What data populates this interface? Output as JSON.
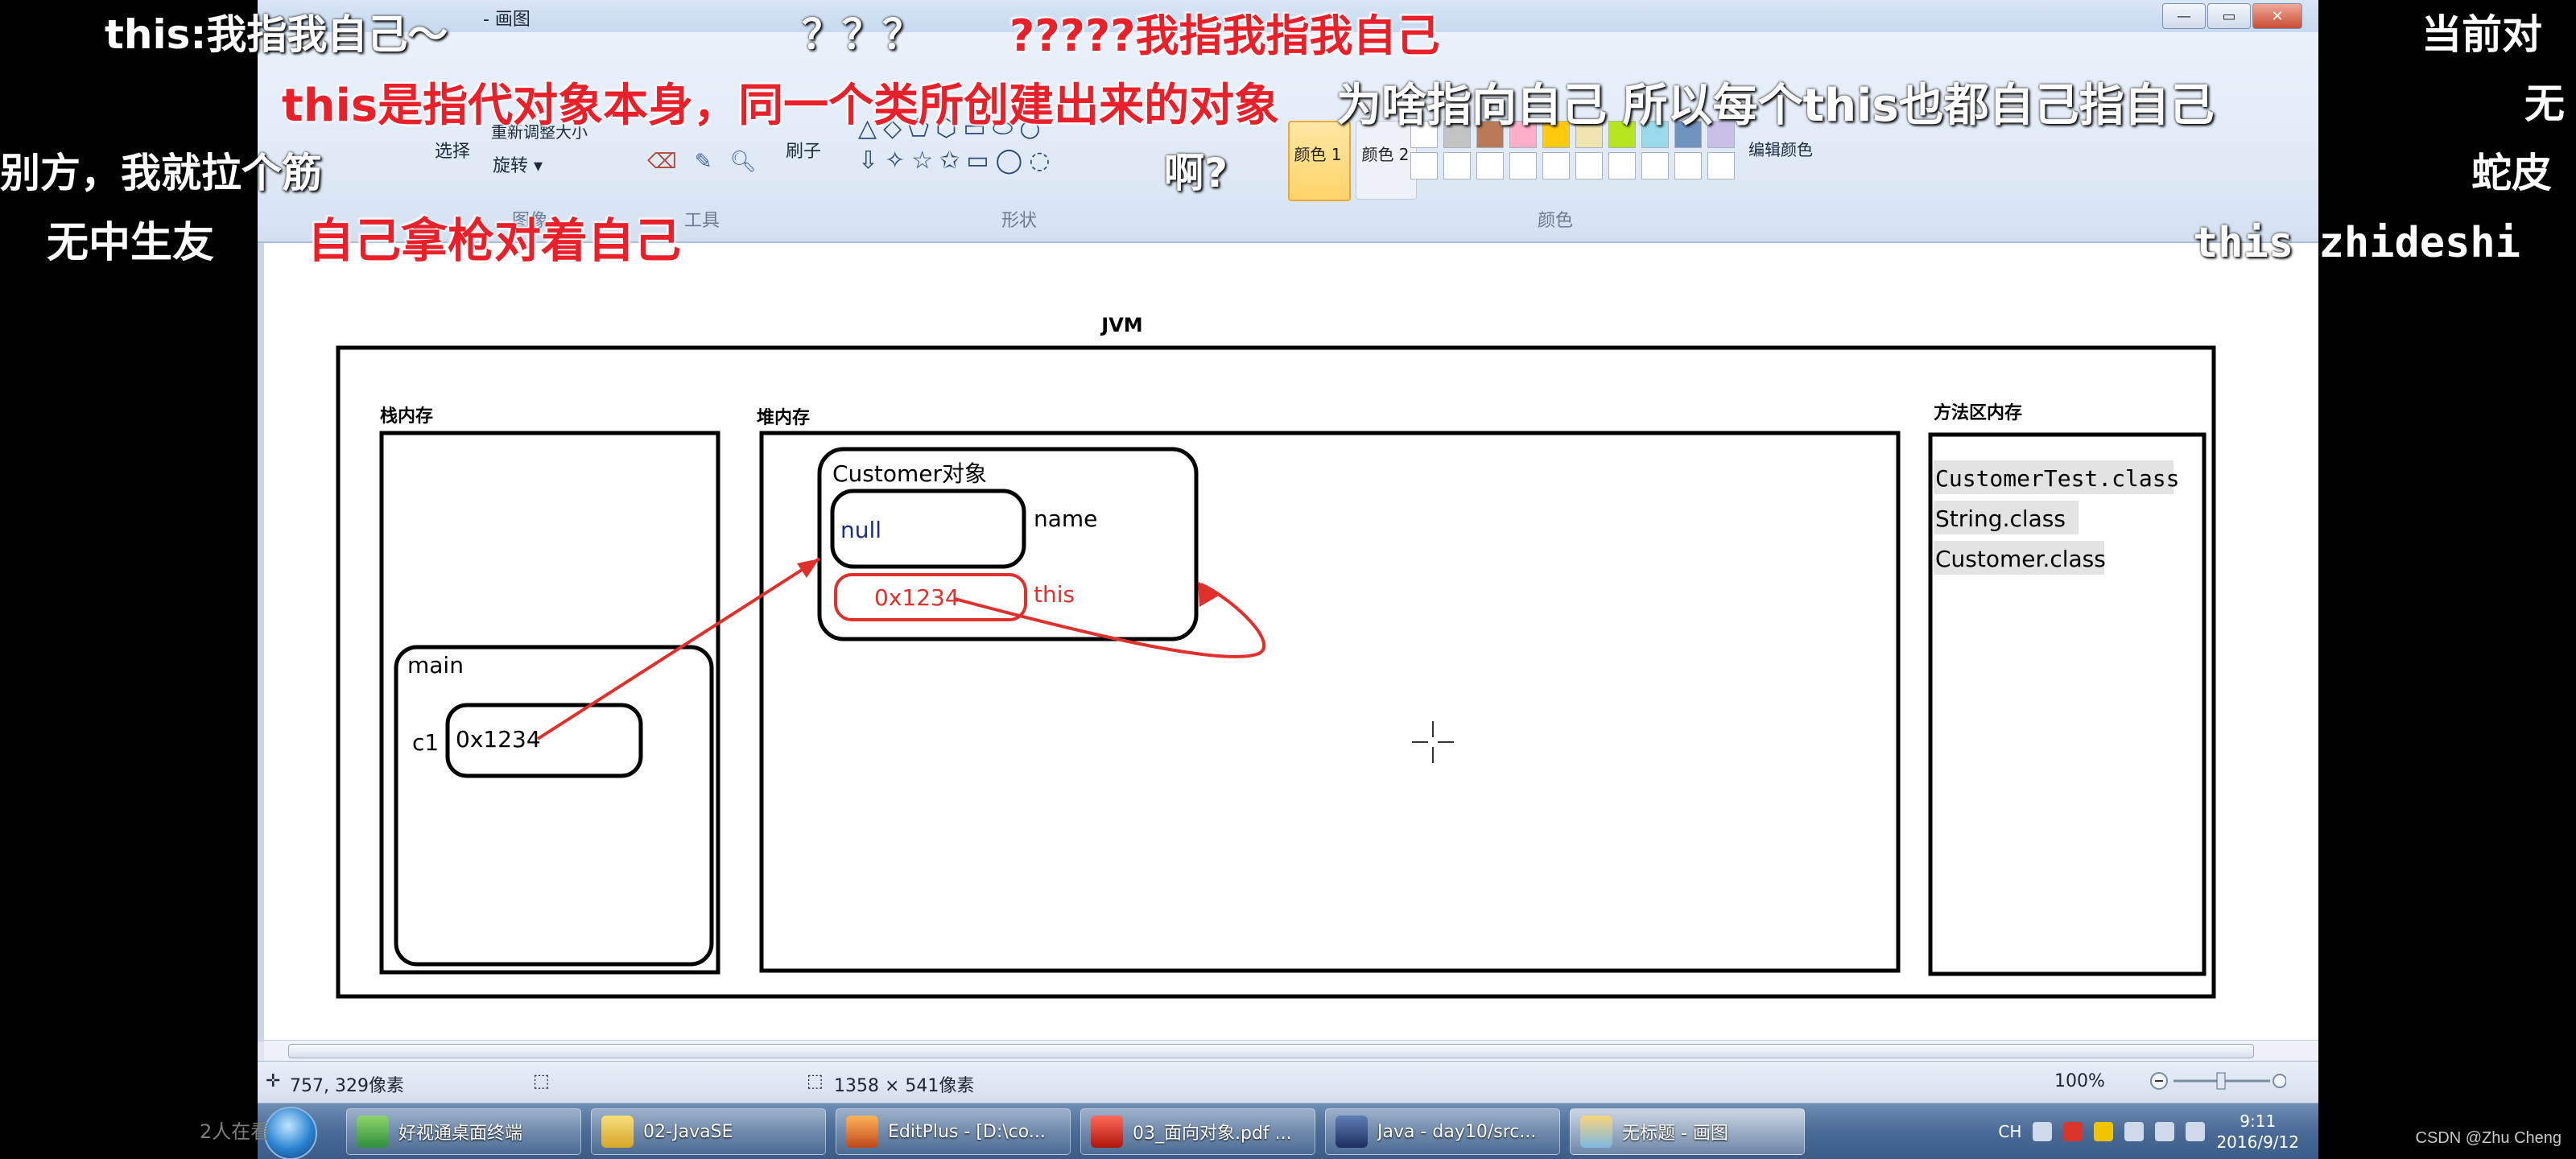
{
  "app": {
    "title_fragment": "- 画图"
  },
  "ribbon": {
    "groups": [
      {
        "label": "图像"
      },
      {
        "label": "工具"
      },
      {
        "label": "形状"
      },
      {
        "label": "颜色"
      }
    ],
    "select_label": "选择",
    "rotate_label": "旋转 ▾",
    "resize_label": "重新调整大小",
    "brush_label": "刷子",
    "color1_label": "颜色 1",
    "color2_label": "颜色 2",
    "edit_colors_label": "编辑颜色"
  },
  "diagram": {
    "title": "JVM",
    "stack": {
      "label": "栈内存",
      "frame": "main",
      "var_name": "c1",
      "var_value": "0x1234"
    },
    "heap": {
      "label": "堆内存",
      "object_title": "Customer对象",
      "field_value": "null",
      "field_name": "name",
      "this_value": "0x1234",
      "this_name": "this"
    },
    "method_area": {
      "label": "方法区内存",
      "classes": [
        "CustomerTest.class",
        "String.class",
        "Customer.class"
      ]
    }
  },
  "statusbar": {
    "cursor_pos": "757, 329像素",
    "canvas_size": "1358 × 541像素",
    "zoom": "100%"
  },
  "taskbar": {
    "items": [
      {
        "label": "好视通桌面终端"
      },
      {
        "label": "02-JavaSE"
      },
      {
        "label": "EditPlus - [D:\\co..."
      },
      {
        "label": "03_面向对象.pdf ..."
      },
      {
        "label": "Java - day10/src..."
      },
      {
        "label": "无标题 - 画图"
      }
    ],
    "lang": "CH",
    "time": "9:11",
    "date": "2016/9/12"
  },
  "danmaku": {
    "d1": "this:我指我自己～",
    "d2": "？？？",
    "d3": "?????我指我指我自己",
    "d4": "this是指代对象本身，同一个类所创建出来的对象",
    "d5": "为啥指向自己 所以每个this也都自己指自己",
    "d6": "啊?",
    "d7": "别方，我就拉个筋",
    "d8": "无中生友",
    "d9": "自己拿枪对着自己",
    "d10": "当前对",
    "d11": "无",
    "d12": "蛇皮",
    "d13": "this zhideshi"
  },
  "overlay": {
    "viewer_note": "2人在看",
    "watermark": "CSDN @Zhu Cheng"
  },
  "colors": {
    "arrow_red": "#e0302c",
    "primary_highlight": "#f4b63c"
  }
}
